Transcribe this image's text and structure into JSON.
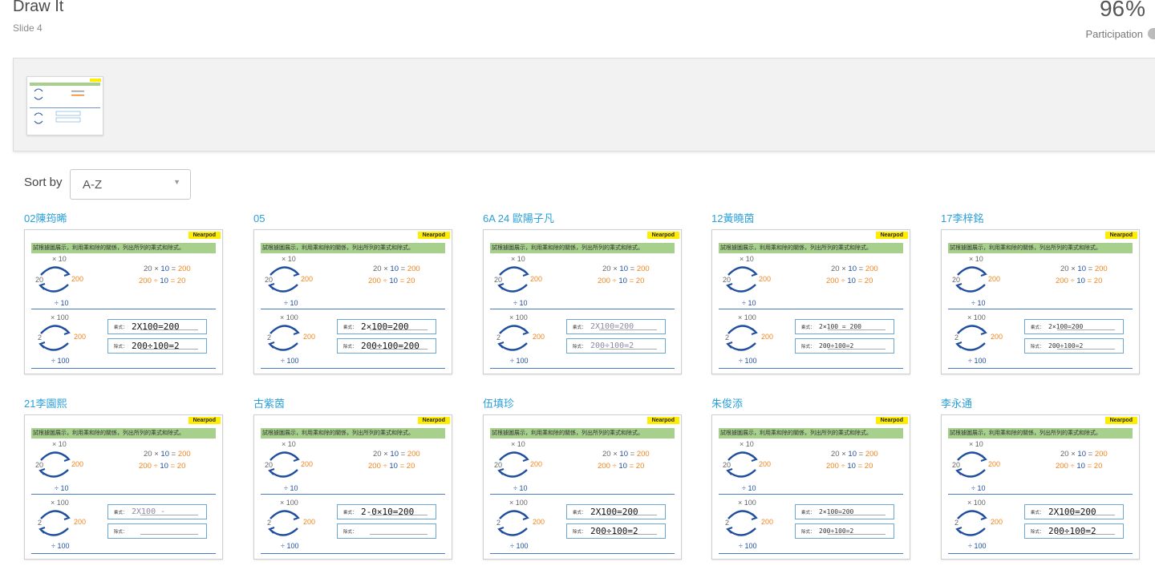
{
  "header": {
    "title": "Draw It",
    "subtitle": "Slide 4",
    "participation_value": "96",
    "participation_sign": "%",
    "participation_label": "Participation"
  },
  "sort": {
    "label": "Sort by",
    "value": "A-Z"
  },
  "slide_template": {
    "badge": "Nearpod",
    "banner": "試根據圖展示，利用乘和除的關係，列出所列的乘式和除式。",
    "top_times": "× 10",
    "top_left": "20",
    "top_right": "200",
    "top_div": "÷ 10",
    "eq1_a": "20",
    "eq1_op": "×",
    "eq1_b": "10",
    "eq1_eq": "=",
    "eq1_c": "200",
    "eq2_a": "200",
    "eq2_op": "÷",
    "eq2_b": "10",
    "eq2_eq": "=",
    "eq2_c": "20",
    "bot_times": "× 100",
    "bot_left": "2",
    "bot_right": "200",
    "bot_div": "÷ 100",
    "label_mult": "乘式：",
    "label_div": "除式："
  },
  "students": [
    {
      "name": "02陳筠晞",
      "mult": "2X100=200",
      "div": "200÷100=2",
      "style": "bold"
    },
    {
      "name": "05",
      "mult": "2×100=200",
      "div": "200÷100=200",
      "style": "script"
    },
    {
      "name": "6A 24 歐陽子凡",
      "mult": "2X100=200",
      "div": "200÷100=2",
      "style": "light"
    },
    {
      "name": "12黃曉茵",
      "mult": "2×100 = 200",
      "div": "200÷100=2",
      "style": "thin"
    },
    {
      "name": "17李梓銘",
      "mult": "2×100=200",
      "div": "200÷100=2",
      "style": "thin"
    },
    {
      "name": "21李園熙",
      "mult": "2X100 -",
      "div": "",
      "style": "light"
    },
    {
      "name": "古紫茵",
      "mult": "2-0×10=200",
      "div": "",
      "style": "script"
    },
    {
      "name": "伍填珍",
      "mult": "2X100=200",
      "div": "200÷100=2",
      "style": "bold"
    },
    {
      "name": "朱俊添",
      "mult": "2×100=200",
      "div": "200÷100=2",
      "style": "thin"
    },
    {
      "name": "李永通",
      "mult": "2X100=200",
      "div": "200÷100=2",
      "style": "bold"
    }
  ]
}
